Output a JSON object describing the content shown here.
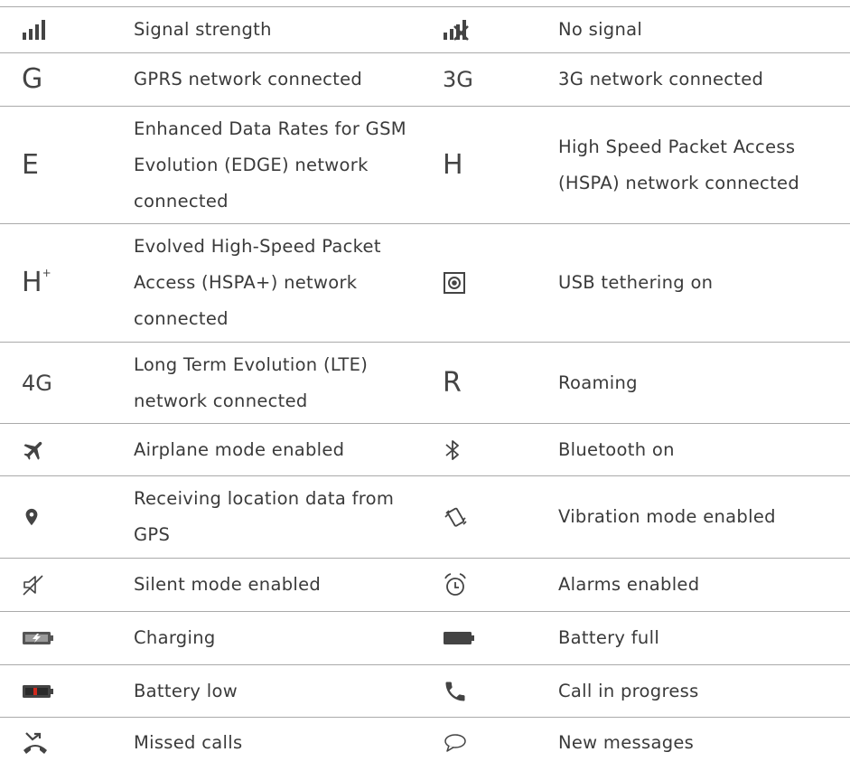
{
  "rows": [
    {
      "left": {
        "icon": "signal-strength-icon",
        "label": "Signal strength"
      },
      "right": {
        "icon": "no-signal-icon",
        "label": "No signal"
      }
    },
    {
      "left": {
        "icon": "gprs-icon",
        "glyph": "G",
        "label": "GPRS network connected"
      },
      "right": {
        "icon": "3g-icon",
        "glyph": "3G",
        "label": "3G network connected"
      }
    },
    {
      "left": {
        "icon": "edge-icon",
        "glyph": "E",
        "label": "Enhanced Data Rates for GSM Evolution (EDGE) network connected"
      },
      "right": {
        "icon": "hspa-icon",
        "glyph": "H",
        "label": "High Speed Packet Access (HSPA) network connected"
      }
    },
    {
      "left": {
        "icon": "hspa-plus-icon",
        "glyph": "H",
        "glyph_sup": "+",
        "label": "Evolved High-Speed Packet Access (HSPA+) network connected"
      },
      "right": {
        "icon": "usb-tethering-icon",
        "label": "USB tethering on"
      }
    },
    {
      "left": {
        "icon": "lte-icon",
        "glyph": "4G",
        "label": "Long Term Evolution (LTE) network connected"
      },
      "right": {
        "icon": "roaming-icon",
        "glyph": "R",
        "label": "Roaming"
      }
    },
    {
      "left": {
        "icon": "airplane-icon",
        "label": "Airplane mode enabled"
      },
      "right": {
        "icon": "bluetooth-icon",
        "label": "Bluetooth on"
      }
    },
    {
      "left": {
        "icon": "location-pin-icon",
        "label": "Receiving location data from GPS"
      },
      "right": {
        "icon": "vibration-icon",
        "label": "Vibration mode enabled"
      }
    },
    {
      "left": {
        "icon": "silent-mode-icon",
        "label": "Silent mode enabled"
      },
      "right": {
        "icon": "alarm-clock-icon",
        "label": "Alarms enabled"
      }
    },
    {
      "left": {
        "icon": "battery-charging-icon",
        "label": "Charging"
      },
      "right": {
        "icon": "battery-full-icon",
        "label": "Battery full"
      }
    },
    {
      "left": {
        "icon": "battery-low-icon",
        "label": "Battery low"
      },
      "right": {
        "icon": "phone-call-icon",
        "label": "Call in progress"
      }
    },
    {
      "left": {
        "icon": "missed-call-icon",
        "label": "Missed calls"
      },
      "right": {
        "icon": "message-bubble-icon",
        "label": "New messages"
      }
    }
  ],
  "colors": {
    "icon": "#444444",
    "rule": "#aaaaaa",
    "text": "#3a3a3a",
    "battery_low_accent": "#d0281c"
  }
}
